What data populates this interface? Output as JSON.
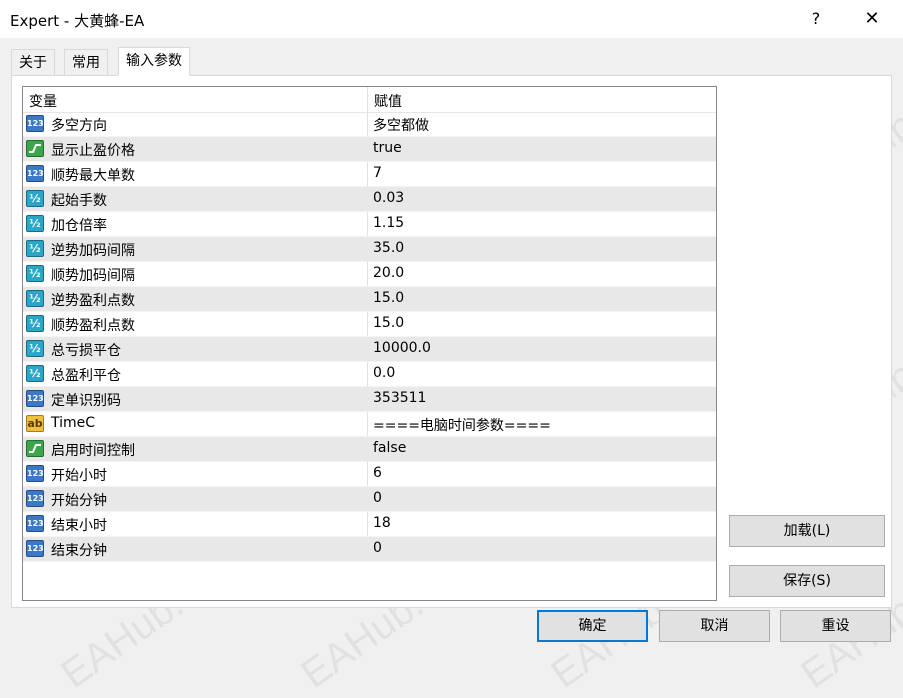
{
  "window": {
    "title": "Expert - 大黄蜂-EA",
    "help_label": "?",
    "close_label": "✕"
  },
  "tabs": [
    {
      "label": "关于"
    },
    {
      "label": "常用"
    },
    {
      "label": "输入参数"
    }
  ],
  "grid": {
    "headers": {
      "variable": "变量",
      "value": "赋值"
    },
    "rows": [
      {
        "name": "多空方向",
        "value": "多空都做",
        "icon": "int-icon"
      },
      {
        "name": "显示止盈价格",
        "value": "true",
        "icon": "bool-icon"
      },
      {
        "name": "顺势最大单数",
        "value": "7",
        "icon": "int-icon"
      },
      {
        "name": "起始手数",
        "value": "0.03",
        "icon": "double-icon"
      },
      {
        "name": "加仓倍率",
        "value": "1.15",
        "icon": "double-icon"
      },
      {
        "name": "逆势加码间隔",
        "value": "35.0",
        "icon": "double-icon"
      },
      {
        "name": "顺势加码间隔",
        "value": "20.0",
        "icon": "double-icon"
      },
      {
        "name": "逆势盈利点数",
        "value": "15.0",
        "icon": "double-icon"
      },
      {
        "name": "顺势盈利点数",
        "value": "15.0",
        "icon": "double-icon"
      },
      {
        "name": "总亏损平仓",
        "value": "10000.0",
        "icon": "double-icon"
      },
      {
        "name": "总盈利平仓",
        "value": "0.0",
        "icon": "double-icon"
      },
      {
        "name": "定单识别码",
        "value": "353511",
        "icon": "int-icon"
      },
      {
        "name": "TimeC",
        "value": "====电脑时间参数====",
        "icon": "string-icon"
      },
      {
        "name": "启用时间控制",
        "value": "false",
        "icon": "bool-icon"
      },
      {
        "name": "开始小时",
        "value": "6",
        "icon": "int-icon"
      },
      {
        "name": "开始分钟",
        "value": "0",
        "icon": "int-icon"
      },
      {
        "name": "结束小时",
        "value": "18",
        "icon": "int-icon"
      },
      {
        "name": "结束分钟",
        "value": "0",
        "icon": "int-icon"
      }
    ]
  },
  "side_buttons": {
    "load": "加载(L)",
    "save": "保存(S)"
  },
  "footer": {
    "ok": "确定",
    "cancel": "取消",
    "reset": "重设"
  },
  "watermark": "EAHub.cn",
  "icon_text": {
    "int": "123",
    "double": "½",
    "string": "ab"
  },
  "colors": {
    "accent": "#0078d7",
    "alt_row": "#e8e8e8",
    "int_icon": "#3c78c8",
    "bool_icon": "#3aa84a",
    "double_icon": "#2aa6c8",
    "string_icon": "#f0c040"
  }
}
